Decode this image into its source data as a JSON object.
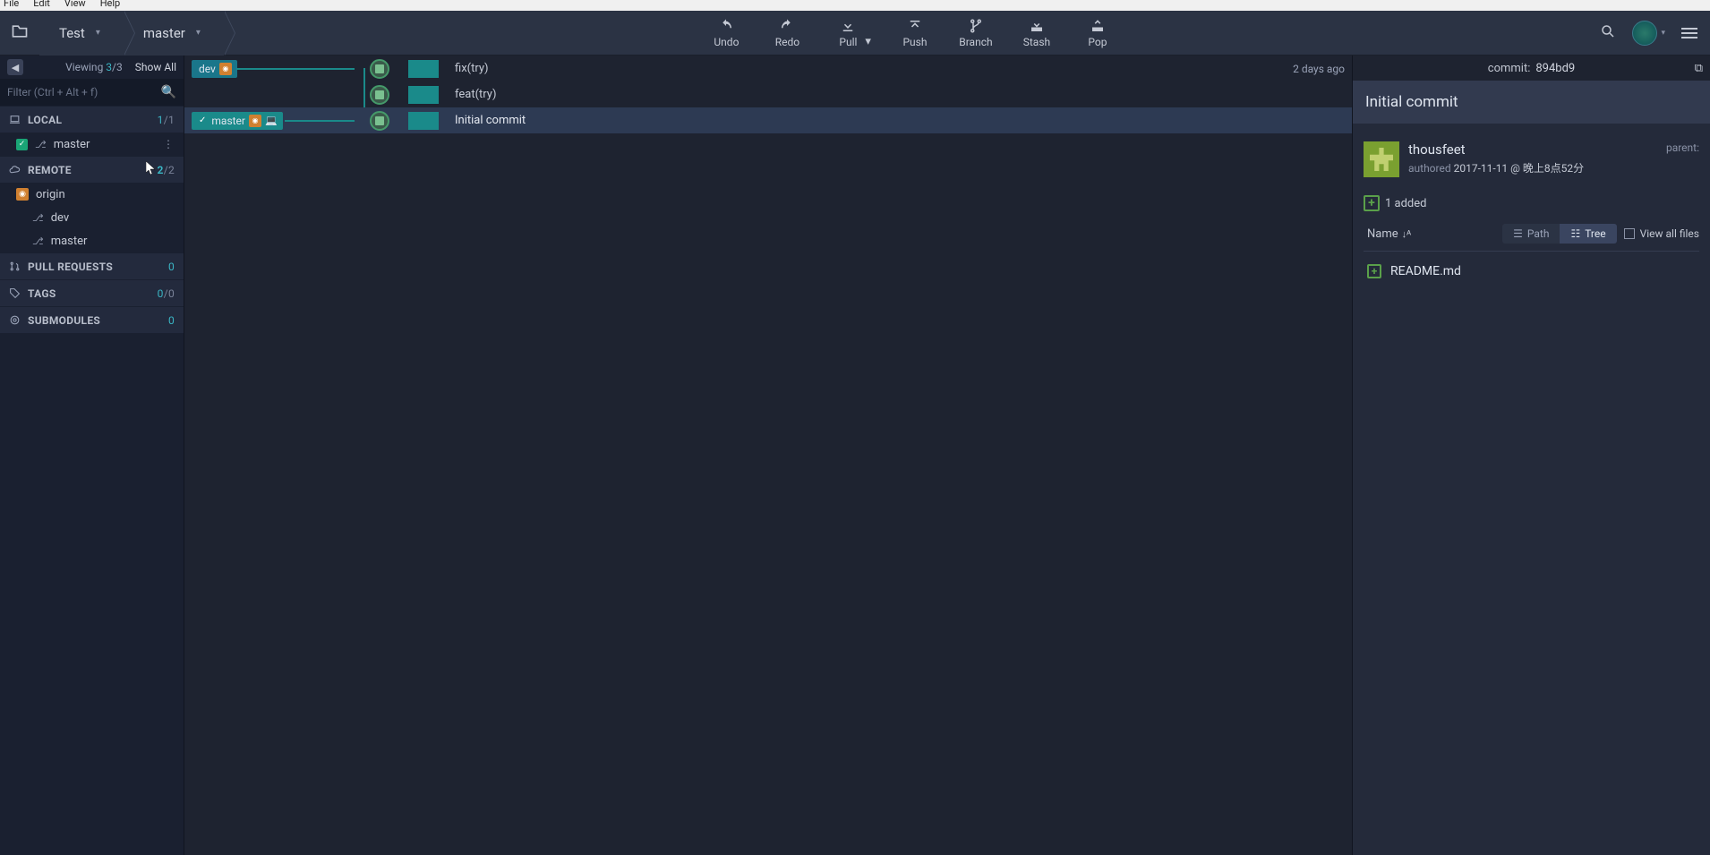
{
  "menubar": [
    "File",
    "Edit",
    "View",
    "Help"
  ],
  "breadcrumb": {
    "repo": "Test",
    "branch": "master"
  },
  "toolbar": {
    "undo": "Undo",
    "redo": "Redo",
    "pull": "Pull",
    "push": "Push",
    "branch": "Branch",
    "stash": "Stash",
    "pop": "Pop"
  },
  "sidebar": {
    "viewing_label": "Viewing",
    "viewing_count": "3",
    "viewing_total": "/3",
    "show_all": "Show All",
    "filter_placeholder": "Filter (Ctrl + Alt + f)",
    "local": {
      "label": "LOCAL",
      "count_a": "1",
      "count_b": "/1",
      "branches": [
        "master"
      ]
    },
    "remote": {
      "label": "REMOTE",
      "count_a": "2",
      "count_b": "/2",
      "origin": "origin",
      "branches": [
        "dev",
        "master"
      ]
    },
    "pull_requests": {
      "label": "PULL REQUESTS",
      "count": "0"
    },
    "tags": {
      "label": "TAGS",
      "count_a": "0",
      "count_b": "/0"
    },
    "submodules": {
      "label": "SUBMODULES",
      "count": "0"
    }
  },
  "commits": [
    {
      "branch_label": "dev",
      "message": "fix(try)",
      "date": "2 days ago"
    },
    {
      "message": "feat(try)"
    },
    {
      "branch_label": "master",
      "checked": true,
      "message": "Initial commit",
      "selected": true
    }
  ],
  "detail": {
    "commit_label": "commit:",
    "hash": "894bd9",
    "title": "Initial commit",
    "author": "thousfeet",
    "authored_label": "authored",
    "date": "2017-11-11 @ 晚上8点52分",
    "parent_label": "parent:",
    "added_count": "1 added",
    "name_label": "Name",
    "path_label": "Path",
    "tree_label": "Tree",
    "view_all_label": "View all files",
    "files": [
      "README.md"
    ]
  }
}
